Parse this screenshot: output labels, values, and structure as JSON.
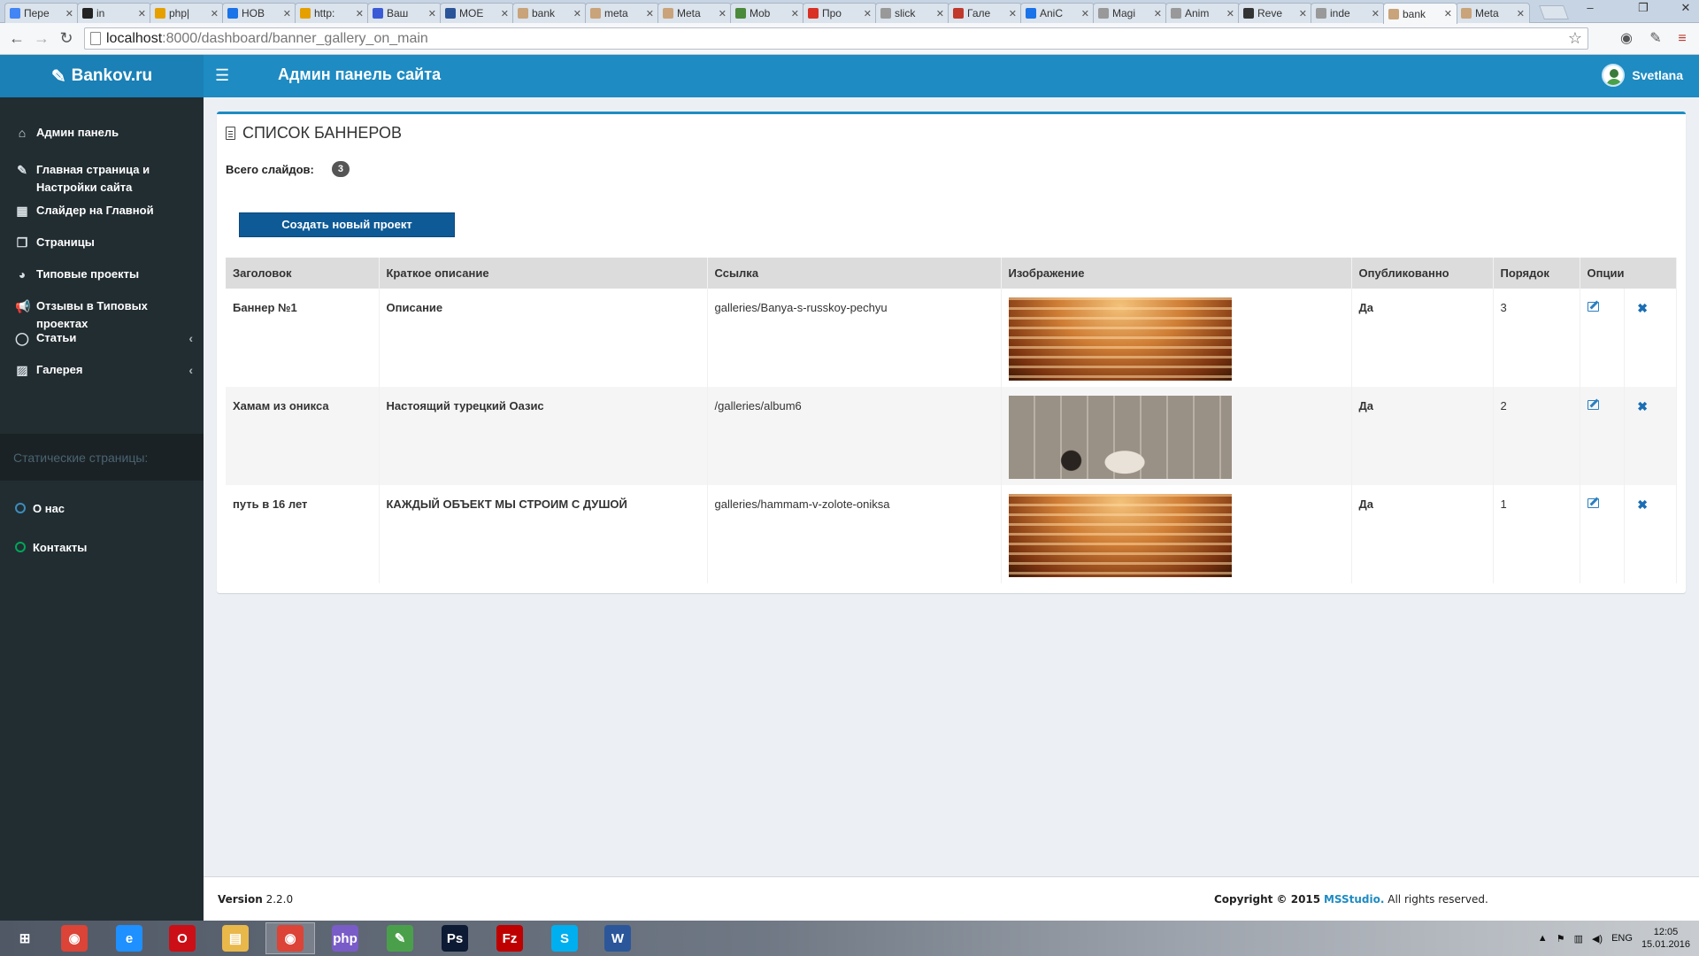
{
  "browser": {
    "tabs": [
      {
        "label": "Пере",
        "color": "#4285f4"
      },
      {
        "label": "in",
        "color": "#222222"
      },
      {
        "label": "php|",
        "color": "#e5a000"
      },
      {
        "label": "НОВ",
        "color": "#1a73e8"
      },
      {
        "label": "http:",
        "color": "#e5a000"
      },
      {
        "label": "Ваш",
        "color": "#3b5bd6"
      },
      {
        "label": "МОЕ",
        "color": "#2a5699"
      },
      {
        "label": "bank",
        "color": "#c9a37a"
      },
      {
        "label": "meta",
        "color": "#c9a37a"
      },
      {
        "label": "Meta",
        "color": "#c9a37a"
      },
      {
        "label": "Mob",
        "color": "#4a8a3a"
      },
      {
        "label": "Про",
        "color": "#d93025"
      },
      {
        "label": "slick",
        "color": "#999999"
      },
      {
        "label": "Гале",
        "color": "#c0392b"
      },
      {
        "label": "AniC",
        "color": "#1a73e8"
      },
      {
        "label": "Magi",
        "color": "#999999"
      },
      {
        "label": "Anim",
        "color": "#999999"
      },
      {
        "label": "Reve",
        "color": "#333333"
      },
      {
        "label": "inde",
        "color": "#999999"
      },
      {
        "label": "bank",
        "color": "#c9a37a",
        "active": true
      },
      {
        "label": "Meta",
        "color": "#c9a37a"
      }
    ],
    "url_host": "localhost",
    "url_path": ":8000/dashboard/banner_gallery_on_main"
  },
  "header": {
    "logo": "Bankov.ru",
    "title": "Админ панель сайта",
    "username": "Svetlana"
  },
  "sidebar": {
    "items": [
      {
        "label": "Админ панель",
        "icon": "home-icon"
      },
      {
        "label": "Главная страница и Настройки сайта",
        "icon": "edit-icon"
      },
      {
        "label": "Слайдер на Главной",
        "icon": "film-icon"
      },
      {
        "label": "Страницы",
        "icon": "copy-icon"
      },
      {
        "label": "Типовые проекты",
        "icon": "pie-chart-icon"
      },
      {
        "label": "Отзывы в Типовых проектах",
        "icon": "bullhorn-icon"
      },
      {
        "label": "Статьи",
        "icon": "comment-icon",
        "chevron": true
      },
      {
        "label": "Галерея",
        "icon": "picture-icon",
        "chevron": true
      }
    ],
    "static_header": "Статические страницы:",
    "static_items": [
      {
        "label": "О нас",
        "color": "#3c8dbc"
      },
      {
        "label": "Контакты",
        "color": "#00a65a"
      }
    ]
  },
  "content": {
    "title": "СПИСОК БАННЕРОВ",
    "count_label": "Всего слайдов:",
    "count": "3",
    "create_button": "Создать новый проект",
    "columns": [
      "Заголовок",
      "Краткое описание",
      "Ссылка",
      "Изображение",
      "Опубликованно",
      "Порядок",
      "Опции"
    ],
    "rows": [
      {
        "title": "Баннер №1",
        "description": "Описание",
        "link": "galleries/Banya-s-russkoy-pechyu",
        "image": "sauna",
        "published": "Да",
        "order": "3"
      },
      {
        "title": "Хамам из оникса",
        "description": "Настоящий турецкий Оазис",
        "link": "/galleries/album6",
        "image": "hamam",
        "published": "Да",
        "order": "2"
      },
      {
        "title": "путь в 16 лет",
        "description": "КАЖДЫЙ ОБЪЕКТ МЫ СТРОИМ С ДУШОЙ",
        "link": "galleries/hammam-v-zolote-oniksa",
        "image": "sauna",
        "published": "Да",
        "order": "1"
      }
    ]
  },
  "footer": {
    "version_label": "Version",
    "version": "2.2.0",
    "copyright_prefix": "Copyright © 2015",
    "company": "MSStudio.",
    "rights": "All rights reserved."
  },
  "taskbar": {
    "apps": [
      {
        "name": "windows-start-icon",
        "label": "⊞",
        "color": "transparent"
      },
      {
        "name": "chrome-icon",
        "label": "◉",
        "color": "#db4437"
      },
      {
        "name": "ie-icon",
        "label": "e",
        "color": "#1e90ff"
      },
      {
        "name": "opera-icon",
        "label": "O",
        "color": "#cc0f16"
      },
      {
        "name": "explorer-icon",
        "label": "▤",
        "color": "#e8b84a"
      },
      {
        "name": "chrome-active-icon",
        "label": "◉",
        "color": "#db4437",
        "active": true
      },
      {
        "name": "phpstorm-icon",
        "label": "php",
        "color": "#7a5cc8"
      },
      {
        "name": "notepad-icon",
        "label": "✎",
        "color": "#4aa04a"
      },
      {
        "name": "photoshop-icon",
        "label": "Ps",
        "color": "#0c1a33"
      },
      {
        "name": "filezilla-icon",
        "label": "Fz",
        "color": "#bf0000"
      },
      {
        "name": "skype-icon",
        "label": "S",
        "color": "#00aff0"
      },
      {
        "name": "word-icon",
        "label": "W",
        "color": "#2b579a"
      }
    ],
    "lang": "ENG",
    "time": "12:05",
    "date": "15.01.2016"
  }
}
